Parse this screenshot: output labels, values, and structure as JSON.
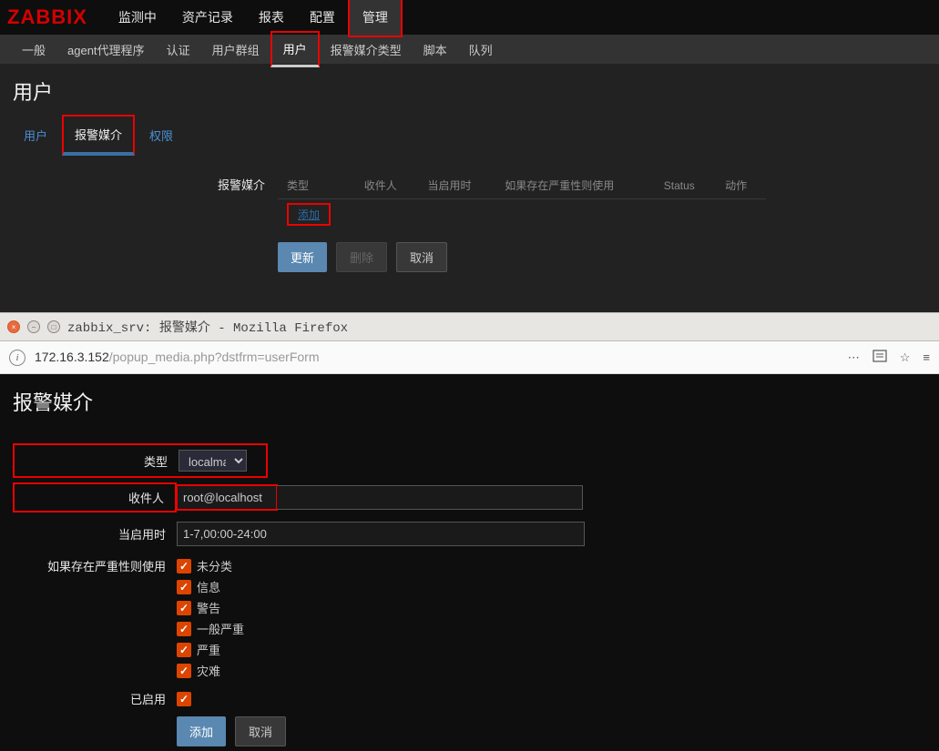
{
  "logo": "ZABBIX",
  "top_nav": {
    "items": [
      "监测中",
      "资产记录",
      "报表",
      "配置",
      "管理"
    ],
    "active": 4
  },
  "sub_nav": {
    "items": [
      "一般",
      "agent代理程序",
      "认证",
      "用户群组",
      "用户",
      "报警媒介类型",
      "脚本",
      "队列"
    ],
    "active": 4
  },
  "page_title": "用户",
  "tabs": {
    "items": [
      "用户",
      "报警媒介",
      "权限"
    ],
    "active": 1
  },
  "media_section": {
    "label": "报警媒介",
    "columns": [
      "类型",
      "收件人",
      "当启用时",
      "如果存在严重性则使用",
      "Status",
      "动作"
    ],
    "add_link": "添加"
  },
  "buttons": {
    "update": "更新",
    "delete": "删除",
    "cancel": "取消"
  },
  "browser": {
    "title": "zabbix_srv: 报警媒介 - Mozilla Firefox",
    "url_host": "172.16.3.152",
    "url_path": "/popup_media.php?dstfrm=userForm"
  },
  "popup": {
    "title": "报警媒介",
    "labels": {
      "type": "类型",
      "recipient": "收件人",
      "when_active": "当启用时",
      "severity": "如果存在严重性则使用",
      "enabled": "已启用"
    },
    "type_value": "localmail",
    "recipient_value": "root@localhost",
    "when_active_value": "1-7,00:00-24:00",
    "severities": [
      "未分类",
      "信息",
      "警告",
      "一般严重",
      "严重",
      "灾难"
    ],
    "enabled": true,
    "add_btn": "添加",
    "cancel_btn": "取消"
  }
}
